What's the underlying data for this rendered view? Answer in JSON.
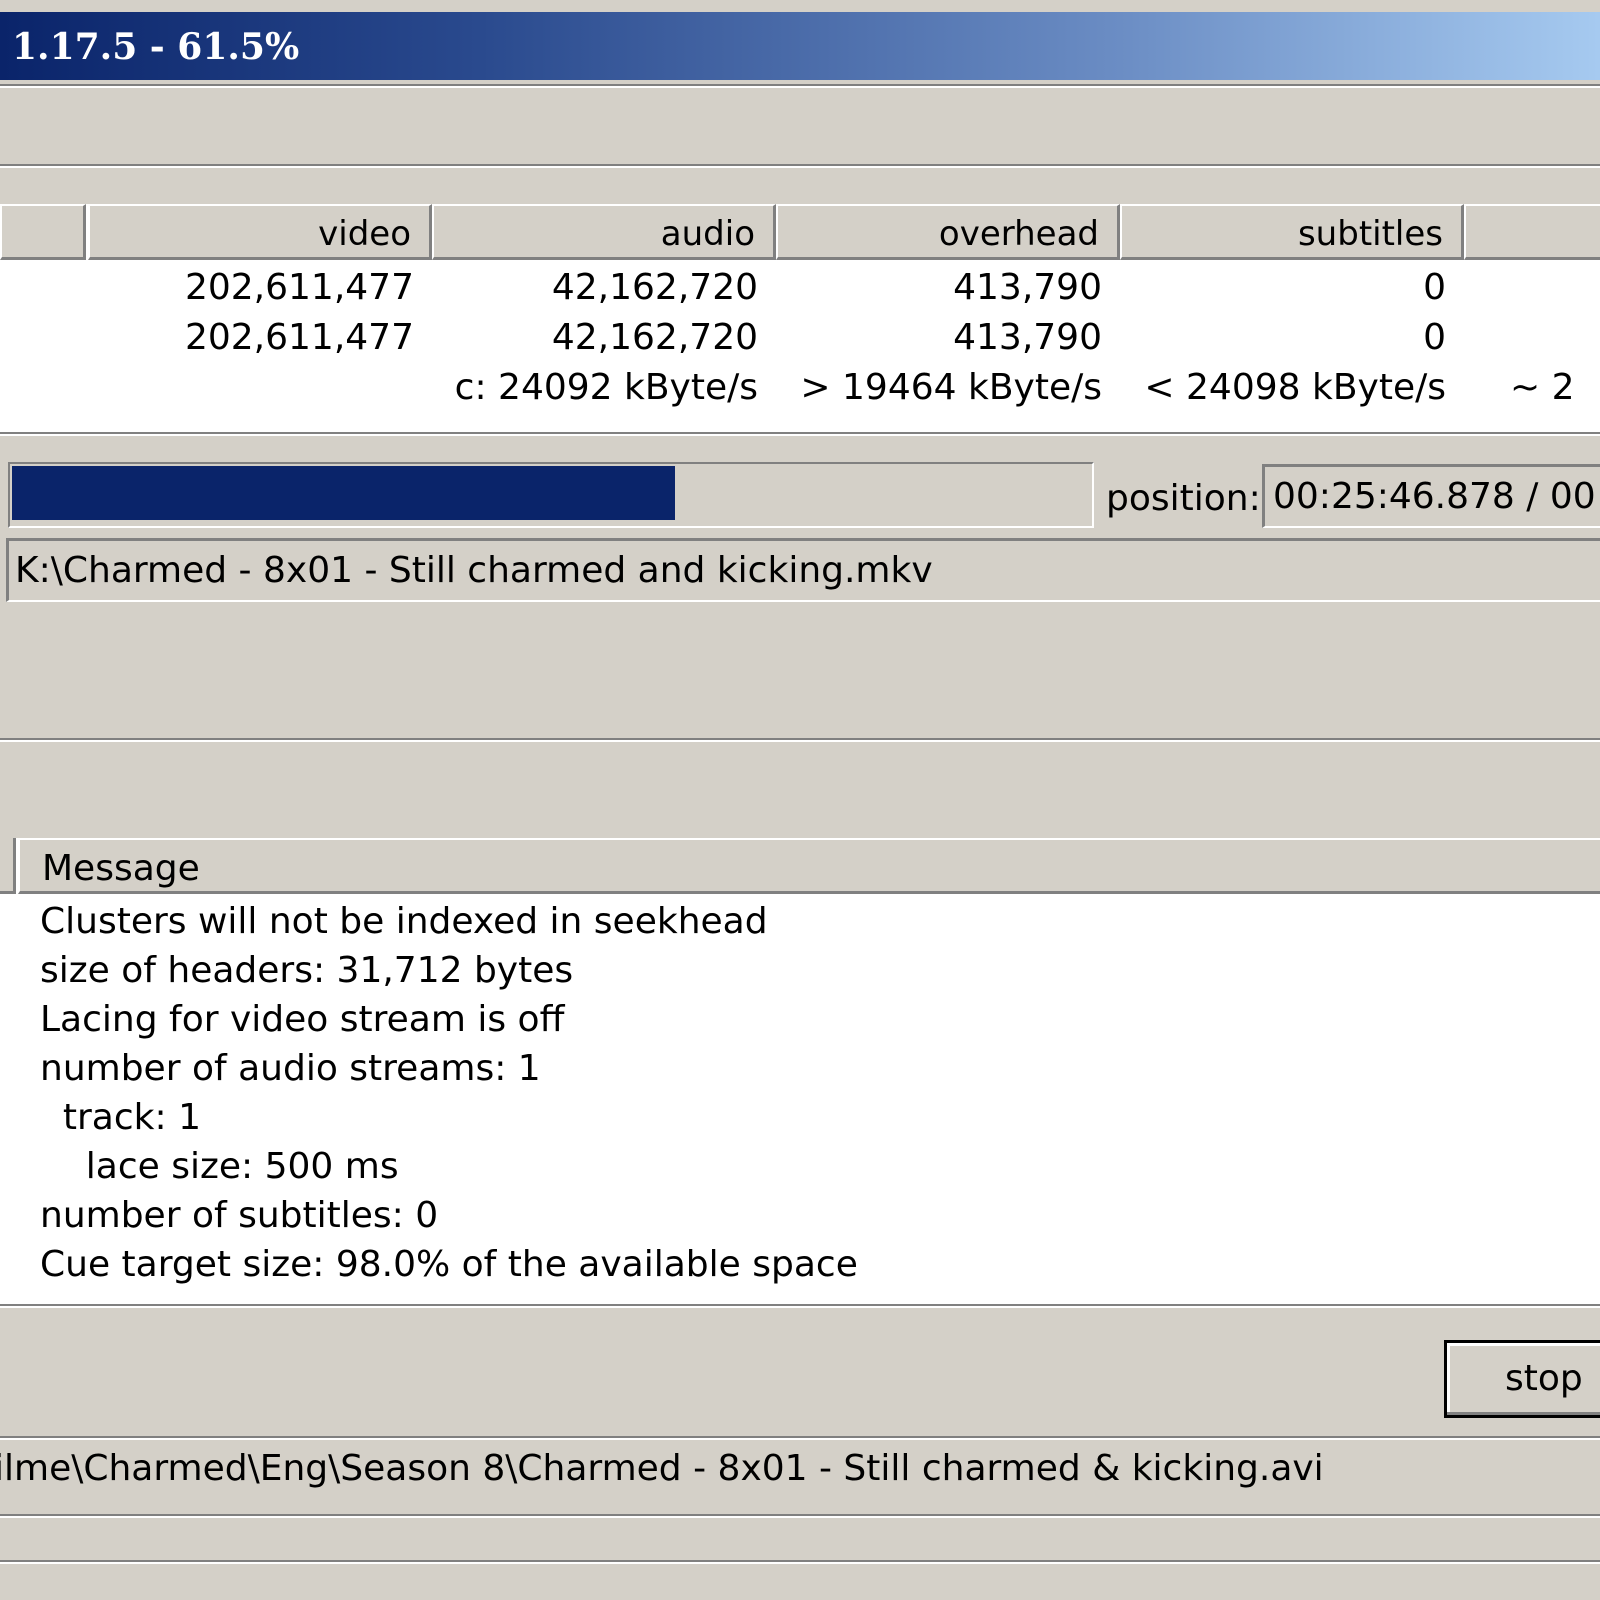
{
  "window": {
    "title": "1.17.5 - 61.5%"
  },
  "stats": {
    "columns": [
      "video",
      "audio",
      "overhead",
      "subtitles"
    ],
    "rows": [
      [
        "202,611,477",
        "42,162,720",
        "413,790",
        "0"
      ],
      [
        "202,611,477",
        "42,162,720",
        "413,790",
        "0"
      ]
    ],
    "rates": [
      "c: 24092 kByte/s",
      "> 19464 kByte/s",
      "< 24098 kByte/s",
      "~ 2"
    ]
  },
  "progress": {
    "fraction": 0.615
  },
  "position": {
    "label": "position:",
    "value": "00:25:46.878 / 00"
  },
  "output_file": "K:\\Charmed - 8x01 - Still charmed and kicking.mkv",
  "log": {
    "column": "Message",
    "lines": [
      "Clusters will not be indexed in seekhead",
      "size of headers: 31,712 bytes",
      "Lacing for video stream is off",
      "number of audio streams: 1",
      "  track: 1",
      "    lace size: 500 ms",
      "number of subtitles: 0",
      "Cue target size: 98.0% of the available space"
    ]
  },
  "buttons": {
    "stop": "stop"
  },
  "status_bar": "ilme\\Charmed\\Eng\\Season 8\\Charmed - 8x01 - Still charmed & kicking.avi",
  "colors": {
    "titlebar_start": "#0a246a",
    "titlebar_end": "#a6caf0",
    "progress_fill": "#0a246a",
    "face": "#d4d0c8"
  }
}
